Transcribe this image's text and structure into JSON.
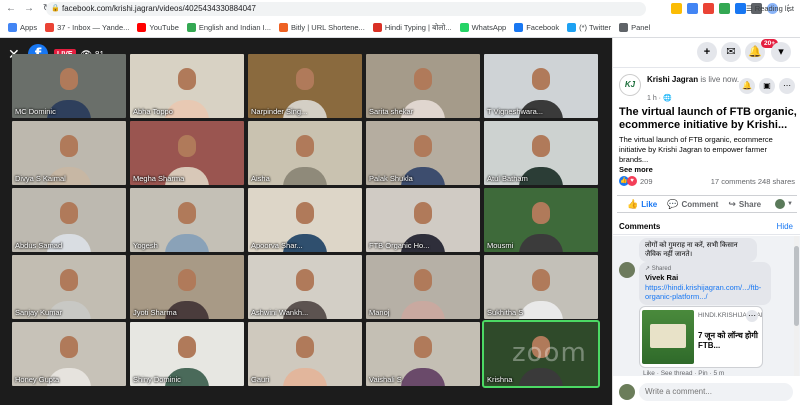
{
  "browser": {
    "url": "facebook.com/krishi.jagran/videos/4025434330884047",
    "bookmarks": [
      {
        "label": "Apps",
        "color": "#4285f4"
      },
      {
        "label": "37 - Inbox — Yande...",
        "color": "#ea4335"
      },
      {
        "label": "YouTube",
        "color": "#ff0000"
      },
      {
        "label": "English and Indian I...",
        "color": "#34a853"
      },
      {
        "label": "Bitly | URL Shortene...",
        "color": "#ee6123"
      },
      {
        "label": "Hindi Typing | बोलो...",
        "color": "#d93025"
      },
      {
        "label": "WhatsApp",
        "color": "#25d366"
      },
      {
        "label": "Facebook",
        "color": "#1877f2"
      },
      {
        "label": "(*) Twitter",
        "color": "#1da1f2"
      },
      {
        "label": "Panel",
        "color": "#5f6368"
      }
    ],
    "reading_list": "Reading list"
  },
  "video": {
    "live_label": "LIVE",
    "viewers": "81",
    "watermark": "zoom",
    "participants": [
      {
        "name": "MC Dominic",
        "bg": "#6a6f6a",
        "shirt": "#2e3f5c"
      },
      {
        "name": "Abha Toppo",
        "bg": "#d8d2c4",
        "shirt": "#e8c9b3"
      },
      {
        "name": "Narpinder Sing...",
        "bg": "#8a6a3e",
        "shirt": "#d4cfc5"
      },
      {
        "name": "Sarita shekar",
        "bg": "#a59b8a",
        "shirt": "#e0d6cf"
      },
      {
        "name": "T Vigneshwara...",
        "bg": "#cfd3d6",
        "shirt": "#3a3a3a"
      },
      {
        "name": "Divya S Kaimal",
        "bg": "#bdb8ae",
        "shirt": "#c7b7a4"
      },
      {
        "name": "Megha Sharma",
        "bg": "#9a5550",
        "shirt": "#d8c8b8"
      },
      {
        "name": "Aisha",
        "bg": "#c9c2b0",
        "shirt": "#8f8a7a"
      },
      {
        "name": "Palak Shukla",
        "bg": "#b5ada0",
        "shirt": "#3d4d6e"
      },
      {
        "name": "Atul Batham",
        "bg": "#cdd2d0",
        "shirt": "#2b3d36"
      },
      {
        "name": "Abdus Samad",
        "bg": "#bdb9b0",
        "shirt": "#d9dde2"
      },
      {
        "name": "Yogesh",
        "bg": "#c4c0b6",
        "shirt": "#8aa2b8"
      },
      {
        "name": "Apoorva Shar...",
        "bg": "#ddd6c8",
        "shirt": "#2f4f6e"
      },
      {
        "name": "FTB Organic Ho...",
        "bg": "#d0cbc4",
        "shirt": "#2e2e3a"
      },
      {
        "name": "Mousmi",
        "bg": "#3e6a3a",
        "shirt": "#3b3b3b"
      },
      {
        "name": "Sanjay Kumar",
        "bg": "#c2bdb2",
        "shirt": "#c8c8c4"
      },
      {
        "name": "Jyoti Sharma",
        "bg": "#a89a86",
        "shirt": "#4a3c3c"
      },
      {
        "name": "Ashwini Wankh...",
        "bg": "#d3cfc6",
        "shirt": "#5c5350"
      },
      {
        "name": "Manoj",
        "bg": "#b6b0a6",
        "shirt": "#c9a9a0"
      },
      {
        "name": "Sukhitha S",
        "bg": "#c3c0b8",
        "shirt": "#e9e9e9"
      },
      {
        "name": "Honey Gupta",
        "bg": "#c7c2b8",
        "shirt": "#e6e3de"
      },
      {
        "name": "Shiny Dominic",
        "bg": "#e7e7e2",
        "shirt": "#4a6a5a"
      },
      {
        "name": "Gauri",
        "bg": "#cfc9be",
        "shirt": "#e2b69c"
      },
      {
        "name": "Vaishali S",
        "bg": "#c4bfb4",
        "shirt": "#6a4a6a"
      },
      {
        "name": "Krishna",
        "bg": "#2f4a2a",
        "shirt": "#3a3a3a"
      }
    ]
  },
  "sidebar": {
    "notifications_count": "20+",
    "page_name": "Krishi Jagran",
    "page_status": " is live now.",
    "post_time": "1 h · 🌐",
    "logo_text": "KJ",
    "title": "The virtual launch of FTB organic, ecommerce initiative by Krishi...",
    "description": "The virtual launch of FTB organic, ecommerce initiative by Krishi Jagran to empower farmer brands...",
    "see_more": "See more",
    "reactions_count": "209",
    "comments_count": "17 comments",
    "shares_count": "248 shares",
    "like_label": "Like",
    "comment_label": "Comment",
    "share_label": "Share",
    "comments_header": "Comments",
    "hide_label": "Hide",
    "comment1_text": "लोगों को गुमराह ना करें, सभी किसान जैविक नहीं जानते।",
    "shared_label": "Shared",
    "comment2_author": "Vivek Rai",
    "comment2_link": "https://hindi.krishijagran.com/.../ftb-organic-platform.../",
    "card_domain": "HINDI.KRISHIJAGRAN.COM",
    "card_title": "7 जून को लॉन्च होगी FTB...",
    "comment_meta": "Like · See thread · Pin · 5 m",
    "write_placeholder": "Write a comment..."
  }
}
